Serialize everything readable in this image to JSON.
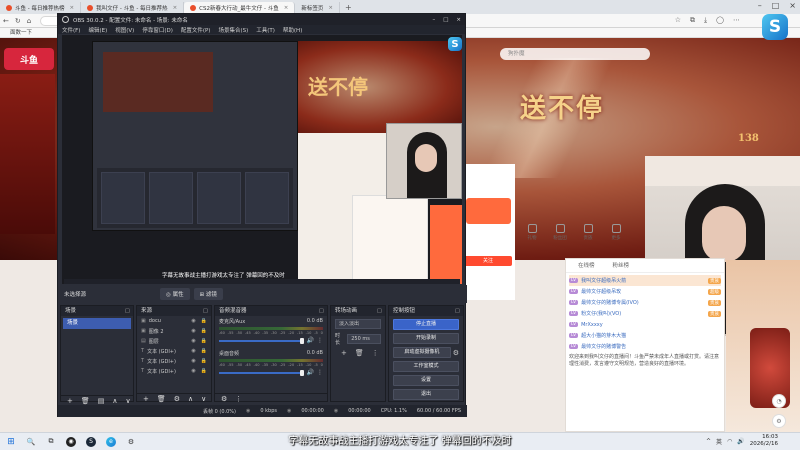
{
  "browser": {
    "tabs": [
      {
        "label": "斗鱼 - 每日推荐热榜",
        "active": false
      },
      {
        "label": "我叫文仔 - 斗鱼 - 每日推荐热",
        "active": false
      },
      {
        "label": "CS2新春大行动_最牛文仔 - 斗鱼",
        "active": true
      },
      {
        "label": "新标签页",
        "active": false
      }
    ],
    "new_tab": "+",
    "url": "",
    "search_placeholder": "狗扑魔",
    "bookmarks": "面数一下"
  },
  "site": {
    "logo": "斗鱼",
    "hero_text": "送不停",
    "hero_small": "138",
    "gifts": [
      "礼物",
      "粉丝团",
      "贵族",
      "更多"
    ],
    "follow": "关注",
    "chat_tabs": [
      "在线榜",
      "粉丝榜"
    ],
    "chat_rows": [
      {
        "name": "我叫文仔超级吊火箭",
        "tag": "贵族",
        "hl": true
      },
      {
        "name": "最帅文仔超级吊玫",
        "tag": "超级",
        "hl": false
      },
      {
        "name": "最帅文仔的赌博专属(IVO)",
        "tag": "贵族",
        "hl": false
      },
      {
        "name": "粉文仔(我叫)(VO)",
        "tag": "贵族",
        "hl": false
      },
      {
        "name": "MrXxxxy",
        "tag": "",
        "hl": false
      },
      {
        "name": "超大小猫的芽木大猫",
        "tag": "",
        "hl": false
      },
      {
        "name": "最帅文仔的赌博警告",
        "tag": "",
        "hl": false
      }
    ],
    "chat_msgs": [
      "欢迎来到我叫文仔的直播间！斗鱼严禁未成年人直播或打赏。请注意理性消费，发言遵守文明规范，营造良好的直播环境。"
    ]
  },
  "obs": {
    "title": "OBS 30.0.2 - 配置文件: 未命名 - 场景: 未命名",
    "menu": [
      "文件(F)",
      "编辑(E)",
      "视图(V)",
      "停靠窗口(D)",
      "配置文件(P)",
      "场景集合(S)",
      "工具(T)",
      "帮助(H)"
    ],
    "preview_caption": "字幕无故事战主播打游戏太专注了 弹幕回的不及时",
    "scene_label": "未选择源",
    "scene_pills": [
      "◎ 属性",
      "⊞ 滤镜"
    ],
    "docks": {
      "scenes": {
        "title": "场景",
        "items": [
          "场景"
        ]
      },
      "sources": {
        "title": "来源",
        "items": [
          "docu",
          "图像 2",
          "图层",
          "文本 (GDI+)",
          "文本 (GDI+)",
          "文本 (GDI+)"
        ]
      },
      "mixer": {
        "title": "音频混音器",
        "channels": [
          {
            "name": "麦克风/Aux",
            "db": "0.0 dB"
          },
          {
            "name": "桌面音频",
            "db": "0.0 dB"
          }
        ],
        "scale": [
          "-60",
          "-55",
          "-50",
          "-45",
          "-40",
          "-35",
          "-30",
          "-25",
          "-20",
          "-15",
          "-10",
          "-5",
          "0"
        ]
      },
      "transitions": {
        "title": "转场动画",
        "type": "淡入淡出",
        "duration_label": "时长",
        "duration": "250 ms"
      },
      "controls": {
        "title": "控制按钮",
        "buttons": [
          "停止直播",
          "开始录制",
          "启动虚拟摄像机",
          "工作室模式",
          "设置",
          "退出"
        ]
      }
    },
    "status": {
      "dropped": "丢帧 0 (0.0%)",
      "bitrate": "0 kbps",
      "live_time": "00:00:00",
      "rec_time": "00:00:00",
      "cpu": "CPU: 1.1%",
      "fps": "60.00 / 60.00 FPS"
    }
  },
  "subtitle": "字幕无故事战主播打游戏太专注了 弹幕回的不及时",
  "taskbar": {
    "icons": [
      "windows-start",
      "search",
      "task-view",
      "obs",
      "steam",
      "edge",
      "settings"
    ],
    "labels": [
      "⊞",
      "🔍",
      "⧉",
      "◉",
      "S",
      "e",
      "⚙"
    ],
    "tray": [
      "^",
      "英"
    ],
    "time": "16:03",
    "date": "2026/2/16"
  },
  "colors": {
    "obs_primary_button": "#3a64c9",
    "site_accent": "#ff6a3d",
    "obs_bg": "#2b2e38"
  }
}
